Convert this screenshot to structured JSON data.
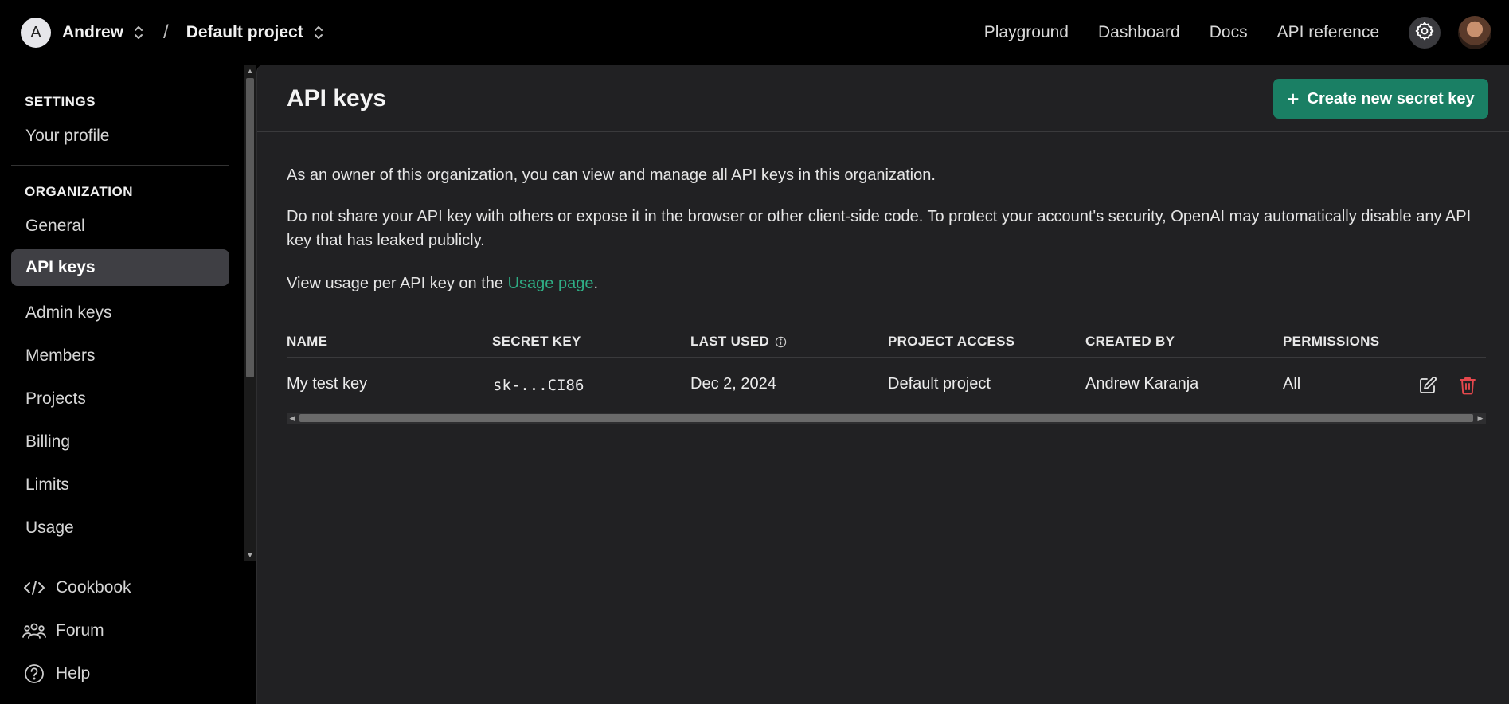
{
  "header": {
    "org_initial": "A",
    "org_name": "Andrew",
    "separator": "/",
    "project_name": "Default project",
    "nav": [
      "Playground",
      "Dashboard",
      "Docs",
      "API reference"
    ]
  },
  "sidebar": {
    "settings_label": "SETTINGS",
    "settings_items": [
      "Your profile"
    ],
    "organization_label": "ORGANIZATION",
    "org_items": [
      "General",
      "API keys",
      "Admin keys",
      "Members",
      "Projects",
      "Billing",
      "Limits",
      "Usage"
    ],
    "active_item": "API keys",
    "bottom_items": [
      "Cookbook",
      "Forum",
      "Help"
    ]
  },
  "main": {
    "title": "API keys",
    "create_button": "Create new secret key",
    "para1": "As an owner of this organization, you can view and manage all API keys in this organization.",
    "para2": "Do not share your API key with others or expose it in the browser or other client-side code. To protect your account's security, OpenAI may automatically disable any API key that has leaked publicly.",
    "para3_prefix": "View usage per API key on the ",
    "para3_link": "Usage page",
    "para3_suffix": ".",
    "table": {
      "columns": [
        "NAME",
        "SECRET KEY",
        "LAST USED",
        "PROJECT ACCESS",
        "CREATED BY",
        "PERMISSIONS"
      ],
      "rows": [
        {
          "name": "My test key",
          "secret_key": "sk-...CI86",
          "last_used": "Dec 2, 2024",
          "project_access": "Default project",
          "created_by": "Andrew Karanja",
          "permissions": "All"
        }
      ]
    }
  },
  "colors": {
    "accent_green": "#1a7f64",
    "link_green": "#2fae85",
    "delete_red": "#e5484d"
  }
}
